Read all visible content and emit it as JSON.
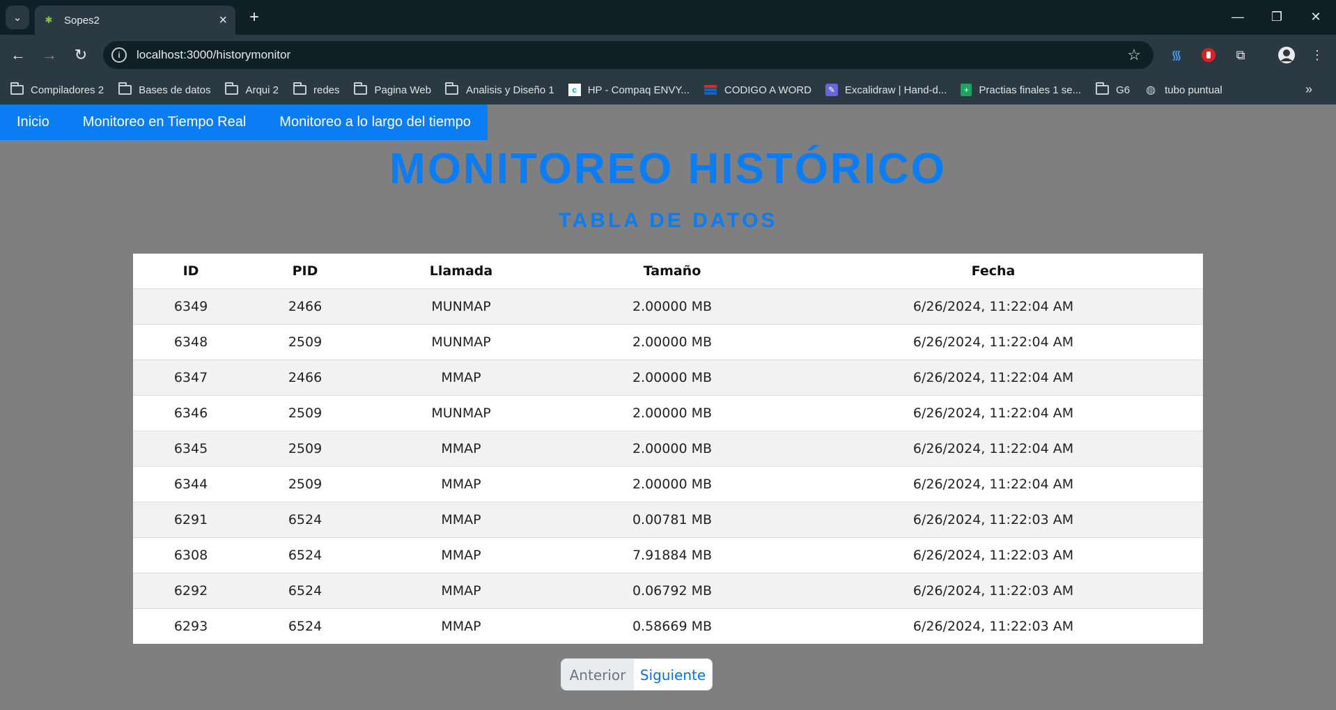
{
  "browser": {
    "tab_title": "Sopes2",
    "url": "localhost:3000/historymonitor",
    "bookmarks": [
      {
        "label": "Compiladores 2",
        "icon": "folder-icon"
      },
      {
        "label": "Bases de datos",
        "icon": "folder-icon"
      },
      {
        "label": "Arqui 2",
        "icon": "folder-icon"
      },
      {
        "label": "redes",
        "icon": "folder-icon"
      },
      {
        "label": "Pagina Web",
        "icon": "folder-icon"
      },
      {
        "label": "Analisis y Diseño 1",
        "icon": "folder-icon"
      },
      {
        "label": "HP - Compaq ENVY...",
        "icon": "site-icon"
      },
      {
        "label": "CODIGO A WORD",
        "icon": "site-icon"
      },
      {
        "label": "Excalidraw | Hand-d...",
        "icon": "site-icon"
      },
      {
        "label": "Practias finales 1 se...",
        "icon": "site-icon"
      },
      {
        "label": "G6",
        "icon": "folder-icon"
      },
      {
        "label": "tubo puntual",
        "icon": "globe-icon"
      }
    ]
  },
  "nav": {
    "items": [
      "Inicio",
      "Monitoreo en Tiempo Real",
      "Monitoreo a lo largo del tiempo"
    ]
  },
  "page": {
    "title": "MONITOREO HISTÓRICO",
    "subtitle": "TABLA DE DATOS"
  },
  "table": {
    "headers": [
      "ID",
      "PID",
      "Llamada",
      "Tamaño",
      "Fecha"
    ],
    "rows": [
      [
        "6349",
        "2466",
        "MUNMAP",
        "2.00000 MB",
        "6/26/2024, 11:22:04 AM"
      ],
      [
        "6348",
        "2509",
        "MUNMAP",
        "2.00000 MB",
        "6/26/2024, 11:22:04 AM"
      ],
      [
        "6347",
        "2466",
        "MMAP",
        "2.00000 MB",
        "6/26/2024, 11:22:04 AM"
      ],
      [
        "6346",
        "2509",
        "MUNMAP",
        "2.00000 MB",
        "6/26/2024, 11:22:04 AM"
      ],
      [
        "6345",
        "2509",
        "MMAP",
        "2.00000 MB",
        "6/26/2024, 11:22:04 AM"
      ],
      [
        "6344",
        "2509",
        "MMAP",
        "2.00000 MB",
        "6/26/2024, 11:22:04 AM"
      ],
      [
        "6291",
        "6524",
        "MMAP",
        "0.00781 MB",
        "6/26/2024, 11:22:03 AM"
      ],
      [
        "6308",
        "6524",
        "MMAP",
        "7.91884 MB",
        "6/26/2024, 11:22:03 AM"
      ],
      [
        "6292",
        "6524",
        "MMAP",
        "0.06792 MB",
        "6/26/2024, 11:22:03 AM"
      ],
      [
        "6293",
        "6524",
        "MMAP",
        "0.58669 MB",
        "6/26/2024, 11:22:03 AM"
      ]
    ]
  },
  "pagination": {
    "prev_label": "Anterior",
    "next_label": "Siguiente"
  },
  "colors": {
    "accent": "#0a7cf4",
    "page_bg": "#7f7f7f",
    "chrome_dark": "#0f2027",
    "chrome_toolbar": "#2b3a42"
  }
}
